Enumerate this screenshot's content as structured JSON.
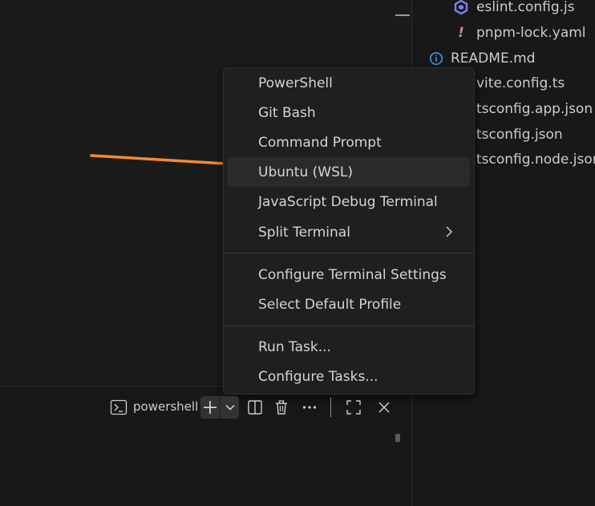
{
  "explorer": {
    "files": [
      {
        "name": "eslint.config.js",
        "icon": "eslint-icon",
        "icon_color": "#8080f2"
      },
      {
        "name": "pnpm-lock.yaml",
        "icon": "exclamation-icon",
        "icon_color": "#c586c0"
      },
      {
        "name": "README.md",
        "icon": "info-icon",
        "icon_color": "#3e9bd6"
      },
      {
        "name": "vite.config.ts",
        "icon": "vite-icon"
      },
      {
        "name": "tsconfig.app.json",
        "icon": "json-icon"
      },
      {
        "name": "tsconfig.json",
        "icon": "json-icon"
      },
      {
        "name": "tsconfig.node.json",
        "icon": "json-icon"
      }
    ]
  },
  "menu": {
    "groups": [
      [
        {
          "label": "PowerShell"
        },
        {
          "label": "Git Bash"
        },
        {
          "label": "Command Prompt"
        },
        {
          "label": "Ubuntu (WSL)",
          "highlighted": true
        },
        {
          "label": "JavaScript Debug Terminal"
        },
        {
          "label": "Split Terminal",
          "submenu": true
        }
      ],
      [
        {
          "label": "Configure Terminal Settings"
        },
        {
          "label": "Select Default Profile"
        }
      ],
      [
        {
          "label": "Run Task..."
        },
        {
          "label": "Configure Tasks..."
        }
      ]
    ]
  },
  "terminal_toolbar": {
    "terminal_name": "powershell",
    "icons": [
      "terminal-icon",
      "plus-icon",
      "chevron-down-icon",
      "split-icon",
      "trash-icon",
      "more-icon",
      "maximize-icon",
      "close-icon"
    ]
  },
  "colors": {
    "accent_arrow": "#f58a33",
    "menu_background": "#1f1f1f",
    "menu_highlight": "#2a2a2a",
    "text": "#cccccc"
  }
}
